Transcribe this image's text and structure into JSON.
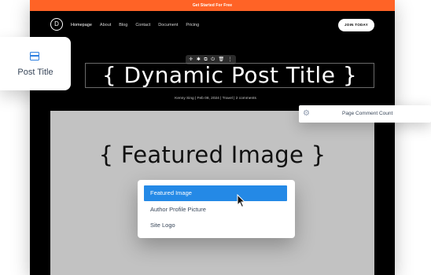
{
  "promo_bar": {
    "text": "Get Started For Free"
  },
  "brand": {
    "logo_letter": "D"
  },
  "nav": {
    "items": [
      {
        "label": "Homepage",
        "active": true
      },
      {
        "label": "About"
      },
      {
        "label": "Blog"
      },
      {
        "label": "Contact"
      },
      {
        "label": "Document"
      },
      {
        "label": "Pricing"
      }
    ],
    "cta_label": "JOIN TODAY"
  },
  "module_toolbar": {
    "icons": [
      "move-icon",
      "gear-icon",
      "duplicate-icon",
      "power-icon",
      "trash-icon",
      "more-icon"
    ],
    "glyphs": [
      "✛",
      "✱",
      "⧉",
      "⏻",
      "🗑",
      "⋮"
    ]
  },
  "post": {
    "title": "{ Dynamic Post Title }",
    "meta": "Kenny Sing | Feb 08, 2024 | Travel | 2 comments",
    "featured_image_placeholder": "{ Featured Image }"
  },
  "post_title_card": {
    "label": "Post Title"
  },
  "comment_tag": {
    "label": "Page Comment Count"
  },
  "dropdown": {
    "options": [
      {
        "label": "Featured Image",
        "selected": true
      },
      {
        "label": "Author Profile Picture"
      },
      {
        "label": "Site Logo"
      }
    ]
  },
  "colors": {
    "accent": "#ff6326",
    "selection": "#2489e6",
    "icon_blue": "#2d7fe0",
    "placeholder_bg": "#c2c2c2"
  }
}
